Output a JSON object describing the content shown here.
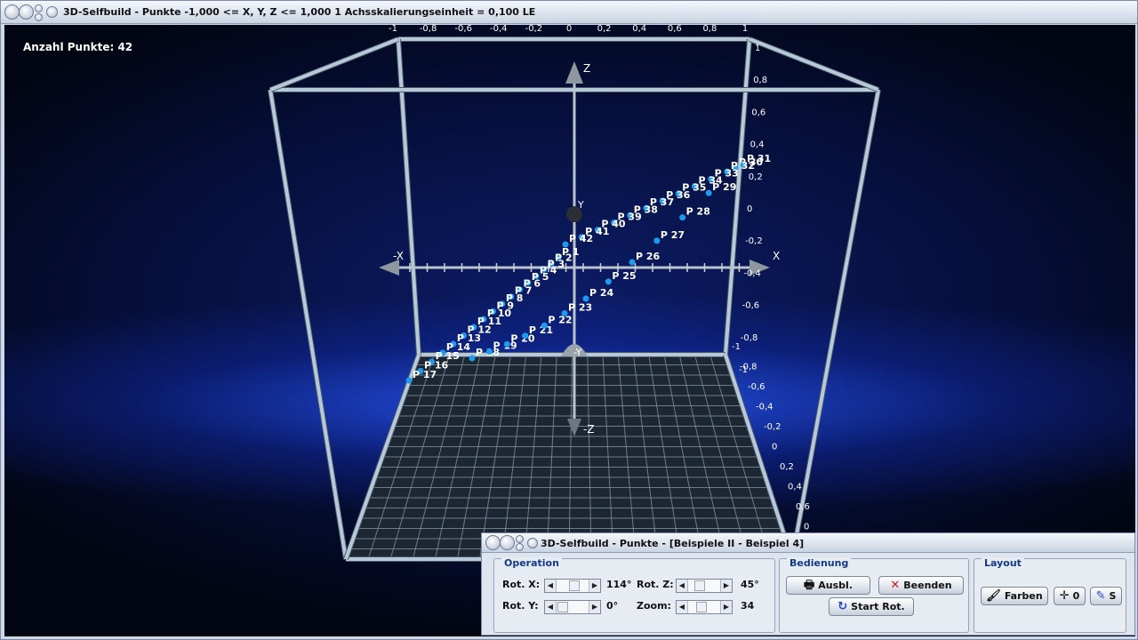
{
  "window": {
    "title": "3D-Selfbuild - Punkte   -1,000 <= X, Y, Z <= 1,000    1 Achsskalierungseinheit = 0,100 LE"
  },
  "viewport": {
    "point_count_label": "Anzahl Punkte: 42",
    "axis_labels": {
      "x_pos": "X",
      "x_neg": "-X",
      "y_pos": "Y",
      "y_neg": "-Y",
      "z_pos": "Z",
      "z_neg": "-Z"
    },
    "top_ticks": [
      "-1",
      "-0,8",
      "-0,6",
      "-0,4",
      "-0,2",
      "0",
      "0,2",
      "0,4",
      "0,6",
      "0,8",
      "1"
    ],
    "right_ticks": [
      "1",
      "0,8",
      "0,6",
      "0,4",
      "0,2",
      "0",
      "-0,2",
      "-0,4",
      "-0,6",
      "-0,8",
      "-1"
    ],
    "right_ticks_lower": [
      "-1",
      "-0,8",
      "-0,6",
      "-0,4",
      "-0,2",
      "0",
      "0,2",
      "0,4",
      "0,6",
      "0"
    ],
    "colors": {
      "point": "#1e9bf0",
      "frame": "#b7c8d8",
      "label": "#ffffff"
    },
    "points": [
      {
        "label": "P 1"
      },
      {
        "label": "P 2"
      },
      {
        "label": "P 3"
      },
      {
        "label": "P 4"
      },
      {
        "label": "P 5"
      },
      {
        "label": "P 6"
      },
      {
        "label": "P 7"
      },
      {
        "label": "P 8"
      },
      {
        "label": "P 9"
      },
      {
        "label": "P 10"
      },
      {
        "label": "P 11"
      },
      {
        "label": "P 12"
      },
      {
        "label": "P 13"
      },
      {
        "label": "P 14"
      },
      {
        "label": "P 15"
      },
      {
        "label": "P 16"
      },
      {
        "label": "P 17"
      },
      {
        "label": "P 18"
      },
      {
        "label": "P 19"
      },
      {
        "label": "P 20"
      },
      {
        "label": "P 21"
      },
      {
        "label": "P 22"
      },
      {
        "label": "P 23"
      },
      {
        "label": "P 24"
      },
      {
        "label": "P 25"
      },
      {
        "label": "P 26"
      },
      {
        "label": "P 27"
      },
      {
        "label": "P 28"
      },
      {
        "label": "P 29"
      },
      {
        "label": "P 30"
      },
      {
        "label": "P 31"
      },
      {
        "label": "P 32"
      },
      {
        "label": "P 33"
      },
      {
        "label": "P 34"
      },
      {
        "label": "P 35"
      },
      {
        "label": "P 36"
      },
      {
        "label": "P 37"
      },
      {
        "label": "P 38"
      },
      {
        "label": "P 39"
      },
      {
        "label": "P 40"
      },
      {
        "label": "P 41"
      },
      {
        "label": "P 42"
      }
    ]
  },
  "control_panel": {
    "title": "3D-Selfbuild - Punkte - [Beispiele II - Beispiel 4]",
    "operation": {
      "title": "Operation",
      "rot_x_label": "Rot. X:",
      "rot_x_value": "114°",
      "rot_y_label": "Rot. Y:",
      "rot_y_value": "0°",
      "rot_z_label": "Rot. Z:",
      "rot_z_value": "45°",
      "zoom_label": "Zoom:",
      "zoom_value": "34"
    },
    "bedienung": {
      "title": "Bedienung",
      "print_label": "Ausbl.",
      "quit_label": "Beenden",
      "start_rot_label": "Start Rot."
    },
    "layout": {
      "title": "Layout",
      "colors_label": "Farben",
      "origin_label": "0",
      "s_label": "S"
    }
  }
}
